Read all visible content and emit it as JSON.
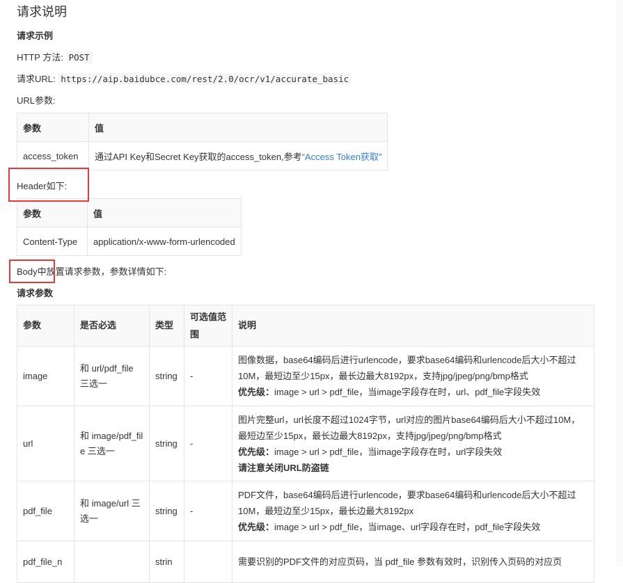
{
  "section_title": "请求说明",
  "example_heading": "请求示例",
  "http_method_label": "HTTP 方法:",
  "http_method_value": "POST",
  "request_url_label": "请求URL:",
  "request_url_value": "https://aip.baidubce.com/rest/2.0/ocr/v1/accurate_basic",
  "url_params_label": "URL参数:",
  "url_params_table": {
    "headers": [
      "参数",
      "值"
    ],
    "rows": [
      {
        "param": "access_token",
        "value_prefix": "通过API Key和Secret Key获取的access_token,参考",
        "value_link": "“Access Token获取”"
      }
    ]
  },
  "header_label": "Header如下:",
  "header_table": {
    "headers": [
      "参数",
      "值"
    ],
    "rows": [
      {
        "param": "Content-Type",
        "value": "application/x-www-form-urlencoded"
      }
    ]
  },
  "body_label": "Body中放置请求参数，参数详情如下:",
  "request_params_heading": "请求参数",
  "params_table": {
    "headers": [
      "参数",
      "是否必选",
      "类型",
      "可选值范围",
      "说明"
    ],
    "rows": [
      {
        "name": "image",
        "required": "和 url/pdf_file 三选一",
        "type": "string",
        "range": "-",
        "desc": "图像数据，base64编码后进行urlencode，要求base64编码和urlencode后大小不超过10M，最短边至少15px，最长边最大8192px，支持jpg/jpeg/png/bmp格式",
        "priority_label": "优先级：",
        "priority": "image > url > pdf_file，当image字段存在时，url、pdf_file字段失效"
      },
      {
        "name": "url",
        "required": "和 image/pdf_file 三选一",
        "type": "string",
        "range": "-",
        "desc": "图片完整url，url长度不超过1024字节，url对应的图片base64编码后大小不超过10M，最短边至少15px，最长边最大8192px，支持jpg/jpeg/png/bmp格式",
        "priority_label": "优先级：",
        "priority": "image > url > pdf_file，当image字段存在时，url字段失效",
        "note": "请注意关闭URL防盗链"
      },
      {
        "name": "pdf_file",
        "required": "和 image/url 三选一",
        "type": "string",
        "range": "-",
        "desc": "PDF文件，base64编码后进行urlencode，要求base64编码和urlencode后大小不超过10M，最短边至少15px，最长边最大8192px",
        "priority_label": "优先级：",
        "priority": "image > url > pdf_file，当image、url字段存在时，pdf_file字段失效"
      },
      {
        "name": "pdf_file_n",
        "required": "",
        "type": "strin",
        "range": "",
        "desc": "需要识别的PDF文件的对应页码，当 pdf_file 参数有效时，识别传入页码的对应页"
      }
    ]
  },
  "highlight_color": "#e53935",
  "link_color": "#2f7ed8"
}
